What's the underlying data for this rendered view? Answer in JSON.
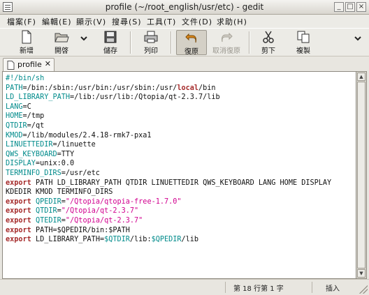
{
  "window": {
    "title": "profile (~/root_english/usr/etc) - gedit"
  },
  "menu": [
    "檔案(F)",
    "編輯(E)",
    "顯示(V)",
    "搜尋(S)",
    "工具(T)",
    "文件(D)",
    "求助(H)"
  ],
  "toolbar": {
    "new": "新增",
    "open": "開啓",
    "save": "儲存",
    "print": "列印",
    "undo": "復原",
    "redo": "取消復原",
    "cut": "剪下",
    "copy": "複製"
  },
  "tab": {
    "label": "profile",
    "close": "✕"
  },
  "code_lines": [
    [
      {
        "t": "#!/bin/sh",
        "c": "var"
      }
    ],
    [
      {
        "t": "PATH",
        "c": "var"
      },
      {
        "t": "=/bin:/sbin:/usr/bin:/usr/sbin:/usr/",
        "c": "plain"
      },
      {
        "t": "local",
        "c": "kw"
      },
      {
        "t": "/bin",
        "c": "plain"
      }
    ],
    [
      {
        "t": "LD_LIBRARY_PATH",
        "c": "var"
      },
      {
        "t": "=/lib:/usr/lib:/Qtopia/qt-2.3.7/lib",
        "c": "plain"
      }
    ],
    [
      {
        "t": "LANG",
        "c": "var"
      },
      {
        "t": "=C",
        "c": "plain"
      }
    ],
    [
      {
        "t": "HOME",
        "c": "var"
      },
      {
        "t": "=/tmp",
        "c": "plain"
      }
    ],
    [
      {
        "t": "QTDIR",
        "c": "var"
      },
      {
        "t": "=/qt",
        "c": "plain"
      }
    ],
    [
      {
        "t": "KMOD",
        "c": "var"
      },
      {
        "t": "=/lib/modules/2.4.18-rmk7-pxa1",
        "c": "plain"
      }
    ],
    [
      {
        "t": "LINUETTEDIR",
        "c": "var"
      },
      {
        "t": "=/linuette",
        "c": "plain"
      }
    ],
    [
      {
        "t": "QWS_KEYBOARD",
        "c": "var"
      },
      {
        "t": "=TTY",
        "c": "plain"
      }
    ],
    [
      {
        "t": "DISPLAY",
        "c": "var"
      },
      {
        "t": "=unix:0.0",
        "c": "plain"
      }
    ],
    [
      {
        "t": "TERMINFO_DIRS",
        "c": "var"
      },
      {
        "t": "=/usr/etc",
        "c": "plain"
      }
    ],
    [
      {
        "t": "export",
        "c": "kw"
      },
      {
        "t": " PATH LD_LIBRARY_PATH QTDIR LINUETTEDIR QWS_KEYBOARD LANG HOME DISPLAY",
        "c": "plain"
      }
    ],
    [
      {
        "t": "KDEDIR KMOD TERMINFO_DIRS",
        "c": "plain"
      }
    ],
    [
      {
        "t": "export",
        "c": "kw"
      },
      {
        "t": " ",
        "c": "plain"
      },
      {
        "t": "QPEDIR",
        "c": "var"
      },
      {
        "t": "=",
        "c": "plain"
      },
      {
        "t": "\"/Qtopia/qtopia-free-1.7.0\"",
        "c": "str"
      }
    ],
    [
      {
        "t": "export",
        "c": "kw"
      },
      {
        "t": " ",
        "c": "plain"
      },
      {
        "t": "QTDIR",
        "c": "var"
      },
      {
        "t": "=",
        "c": "plain"
      },
      {
        "t": "\"/Qtopia/qt-2.3.7\"",
        "c": "str"
      }
    ],
    [
      {
        "t": "export",
        "c": "kw"
      },
      {
        "t": " ",
        "c": "plain"
      },
      {
        "t": "QTEDIR",
        "c": "var"
      },
      {
        "t": "=",
        "c": "plain"
      },
      {
        "t": "\"/Qtopia/qt-2.3.7\"",
        "c": "str"
      }
    ],
    [
      {
        "t": "export",
        "c": "kw"
      },
      {
        "t": " PATH=$QPEDIR/bin:$PATH",
        "c": "plain"
      }
    ],
    [
      {
        "t": "export",
        "c": "kw"
      },
      {
        "t": " LD_LIBRARY_PATH=",
        "c": "plain"
      },
      {
        "t": "$QTDIR",
        "c": "var"
      },
      {
        "t": "/lib:",
        "c": "plain"
      },
      {
        "t": "$QPEDIR",
        "c": "var"
      },
      {
        "t": "/lib",
        "c": "plain"
      }
    ]
  ],
  "status": {
    "position": "第 18 行第 1 字",
    "mode": "插入"
  },
  "colors": {
    "keyword": "#a52a2a",
    "variable": "#008b8b",
    "string": "#d1008f"
  }
}
